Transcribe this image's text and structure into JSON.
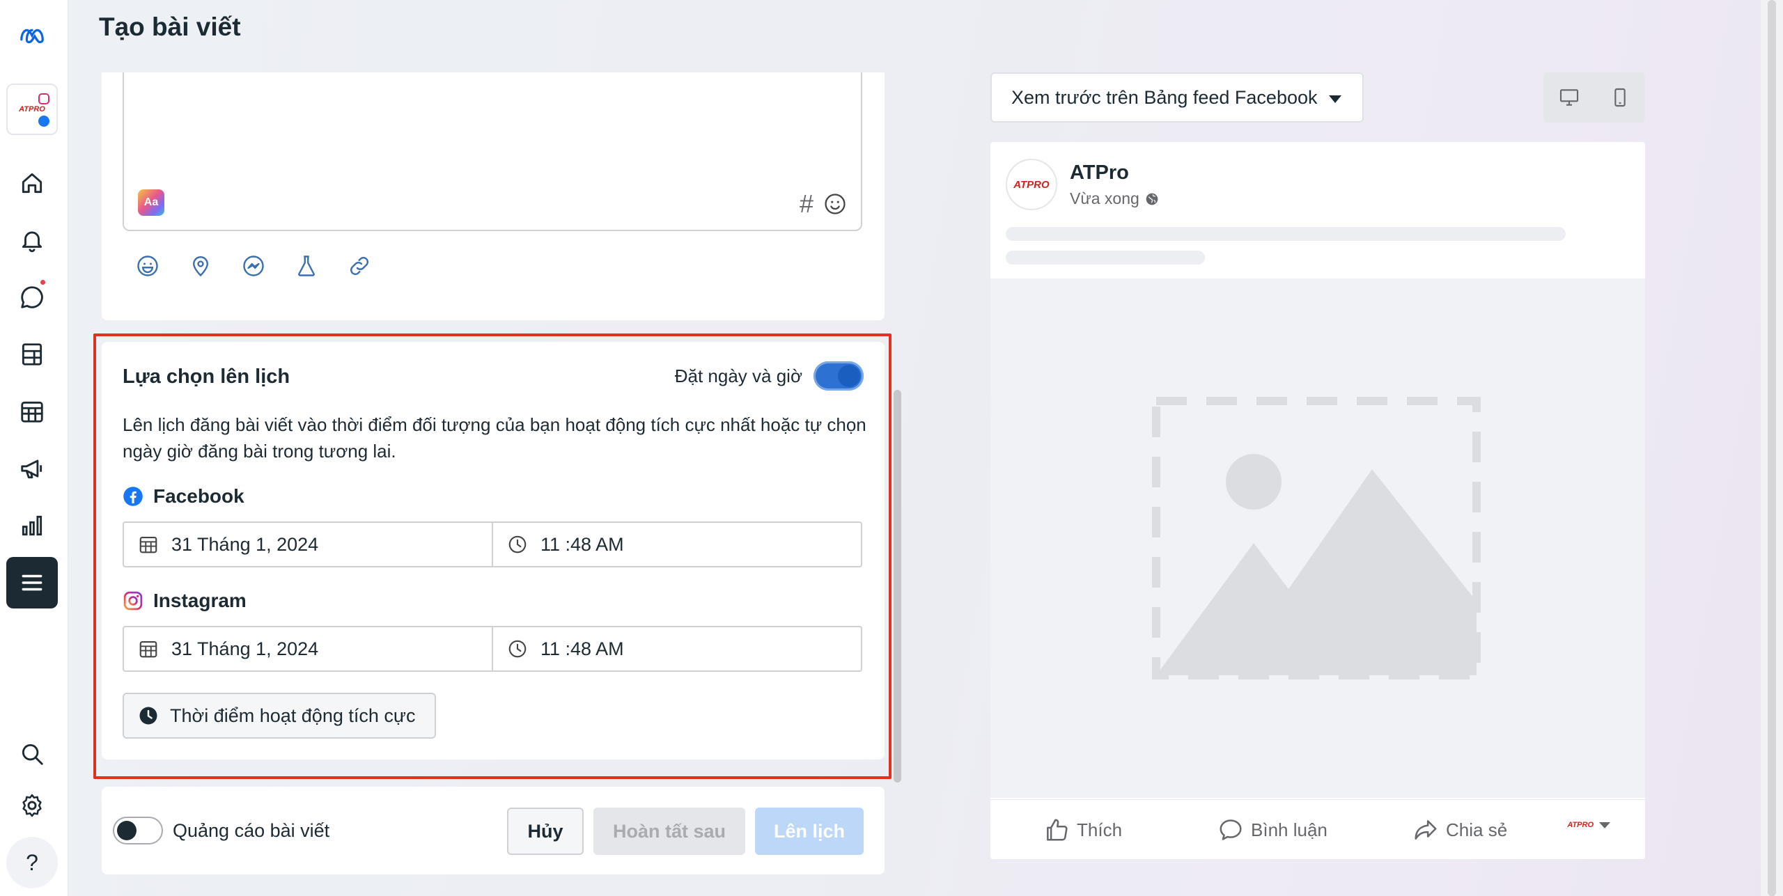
{
  "header": {
    "title": "Tạo bài viết"
  },
  "sidebar": {
    "items": [
      {
        "name": "meta-logo-icon"
      },
      {
        "name": "account-avatar",
        "label": "ATPRO"
      },
      {
        "name": "home-icon"
      },
      {
        "name": "notifications-icon"
      },
      {
        "name": "inbox-icon"
      },
      {
        "name": "content-icon"
      },
      {
        "name": "planner-icon"
      },
      {
        "name": "ads-icon"
      },
      {
        "name": "insights-icon"
      },
      {
        "name": "all-tools-icon"
      },
      {
        "name": "search-icon"
      },
      {
        "name": "settings-icon"
      },
      {
        "name": "help-icon"
      }
    ]
  },
  "composer": {
    "format_badge": "Aa",
    "hashtag_symbol": "#",
    "tools": [
      "emoji-icon",
      "location-icon",
      "messenger-icon",
      "lab-icon",
      "link-icon"
    ]
  },
  "schedule": {
    "title": "Lựa chọn lên lịch",
    "toggle_label": "Đặt ngày và giờ",
    "toggle_on": true,
    "description": "Lên lịch đăng bài viết vào thời điểm đối tượng của bạn hoạt động tích cực nhất hoặc tự chọn ngày giờ đăng bài trong tương lai.",
    "platforms": [
      {
        "name": "Facebook",
        "date": "31 Tháng 1, 2024",
        "time": "11 :48 AM"
      },
      {
        "name": "Instagram",
        "date": "31 Tháng 1, 2024",
        "time": "11 :48 AM"
      }
    ],
    "active_times_button": "Thời điểm hoạt động tích cực"
  },
  "footer": {
    "boost_label": "Quảng cáo bài viết",
    "boost_on": false,
    "cancel": "Hủy",
    "finish_later": "Hoàn tất sau",
    "schedule": "Lên lịch"
  },
  "preview": {
    "select_label": "Xem trước trên Bảng feed Facebook",
    "page_name": "ATPro",
    "post_time": "Vừa xong",
    "avatar_text": "ATPRO",
    "actions": {
      "like": "Thích",
      "comment": "Bình luận",
      "share": "Chia sẻ"
    },
    "mini_page": "ATPRO"
  },
  "colors": {
    "accent": "#2d72d2",
    "highlight_outline": "#e0321f",
    "text": "#1c2b33",
    "muted": "#65676b",
    "facebook_blue": "#1877f2"
  }
}
